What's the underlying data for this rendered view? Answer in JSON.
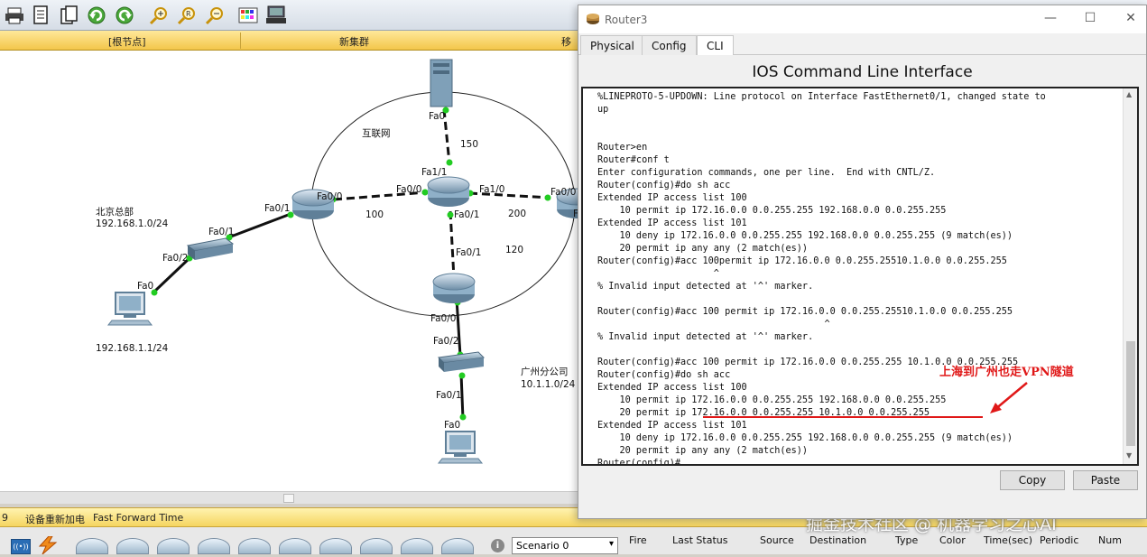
{
  "navbar": {
    "root": "[根节点]",
    "cluster": "新集群",
    "move": "移动"
  },
  "topology": {
    "cloud_label": "互联网",
    "server_port": "Fa0",
    "link_server": "150",
    "core_port_up": "Fa1/1",
    "core_port_left": "Fa0/0",
    "core_port_right": "Fa1/0",
    "core_port_down": "Fa0/1",
    "link_left": "100",
    "link_right": "200",
    "link_down": "120",
    "bj_router_port_left": "Fa0/1",
    "bj_router_port_right": "Fa0/0",
    "right_router_port": "Fa0/0",
    "right_router_port_2": "F",
    "gz_router_port_up": "Fa0/1",
    "gz_router_port_down": "Fa0/0",
    "bj_switch_port_up": "Fa0/1",
    "bj_switch_port_down": "Fa0/2",
    "bj_pc_port": "Fa0",
    "gz_switch_port_up": "Fa0/2",
    "gz_switch_port_down": "Fa0/1",
    "gz_pc_port": "Fa0",
    "bj_site_name": "北京总部",
    "bj_site_net": "192.168.1.0/24",
    "bj_pc_ip": "192.168.1.1/24",
    "gz_site_name": "广州分公司",
    "gz_site_net": "10.1.1.0/24"
  },
  "statusbar": {
    "left_num": "9",
    "power_cycle": "设备重新加电",
    "fast_forward": "Fast Forward Time"
  },
  "bottom": {
    "scenario": "Scenario 0",
    "fire": "Fire",
    "last_status": "Last Status",
    "source": "Source",
    "destination": "Destination",
    "type": "Type",
    "color": "Color",
    "time": "Time(sec)",
    "periodic": "Periodic",
    "num": "Num"
  },
  "watermark": "掘金技术社区 @ 机器学习之心AI",
  "router_window": {
    "title": "Router3",
    "tabs": [
      "Physical",
      "Config",
      "CLI"
    ],
    "active_tab": "CLI",
    "heading": "IOS Command Line Interface",
    "copy_label": "Copy",
    "paste_label": "Paste",
    "cli_text": "%LINEPROTO-5-UPDOWN: Line protocol on Interface FastEthernet0/1, changed state to\nup\n\n\nRouter>en\nRouter#conf t\nEnter configuration commands, one per line.  End with CNTL/Z.\nRouter(config)#do sh acc\nExtended IP access list 100\n    10 permit ip 172.16.0.0 0.0.255.255 192.168.0.0 0.0.255.255\nExtended IP access list 101\n    10 deny ip 172.16.0.0 0.0.255.255 192.168.0.0 0.0.255.255 (9 match(es))\n    20 permit ip any any (2 match(es))\nRouter(config)#acc 100permit ip 172.16.0.0 0.0.255.25510.1.0.0 0.0.255.255\n                     ^\n% Invalid input detected at '^' marker.\n\nRouter(config)#acc 100 permit ip 172.16.0.0 0.0.255.25510.1.0.0 0.0.255.255\n                                         ^\n% Invalid input detected at '^' marker.\n\nRouter(config)#acc 100 permit ip 172.16.0.0 0.0.255.255 10.1.0.0 0.0.255.255\nRouter(config)#do sh acc\nExtended IP access list 100\n    10 permit ip 172.16.0.0 0.0.255.255 192.168.0.0 0.0.255.255\n    20 permit ip 172.16.0.0 0.0.255.255 10.1.0.0 0.0.255.255\nExtended IP access list 101\n    10 deny ip 172.16.0.0 0.0.255.255 192.168.0.0 0.0.255.255 (9 match(es))\n    20 permit ip any any (2 match(es))\nRouter(config)#",
    "annotation": "上海到广州也走VPN隧道"
  },
  "colors": {
    "link_dot": "#22cc22",
    "annotation": "#e01818",
    "navbar": "#f3c64a"
  }
}
